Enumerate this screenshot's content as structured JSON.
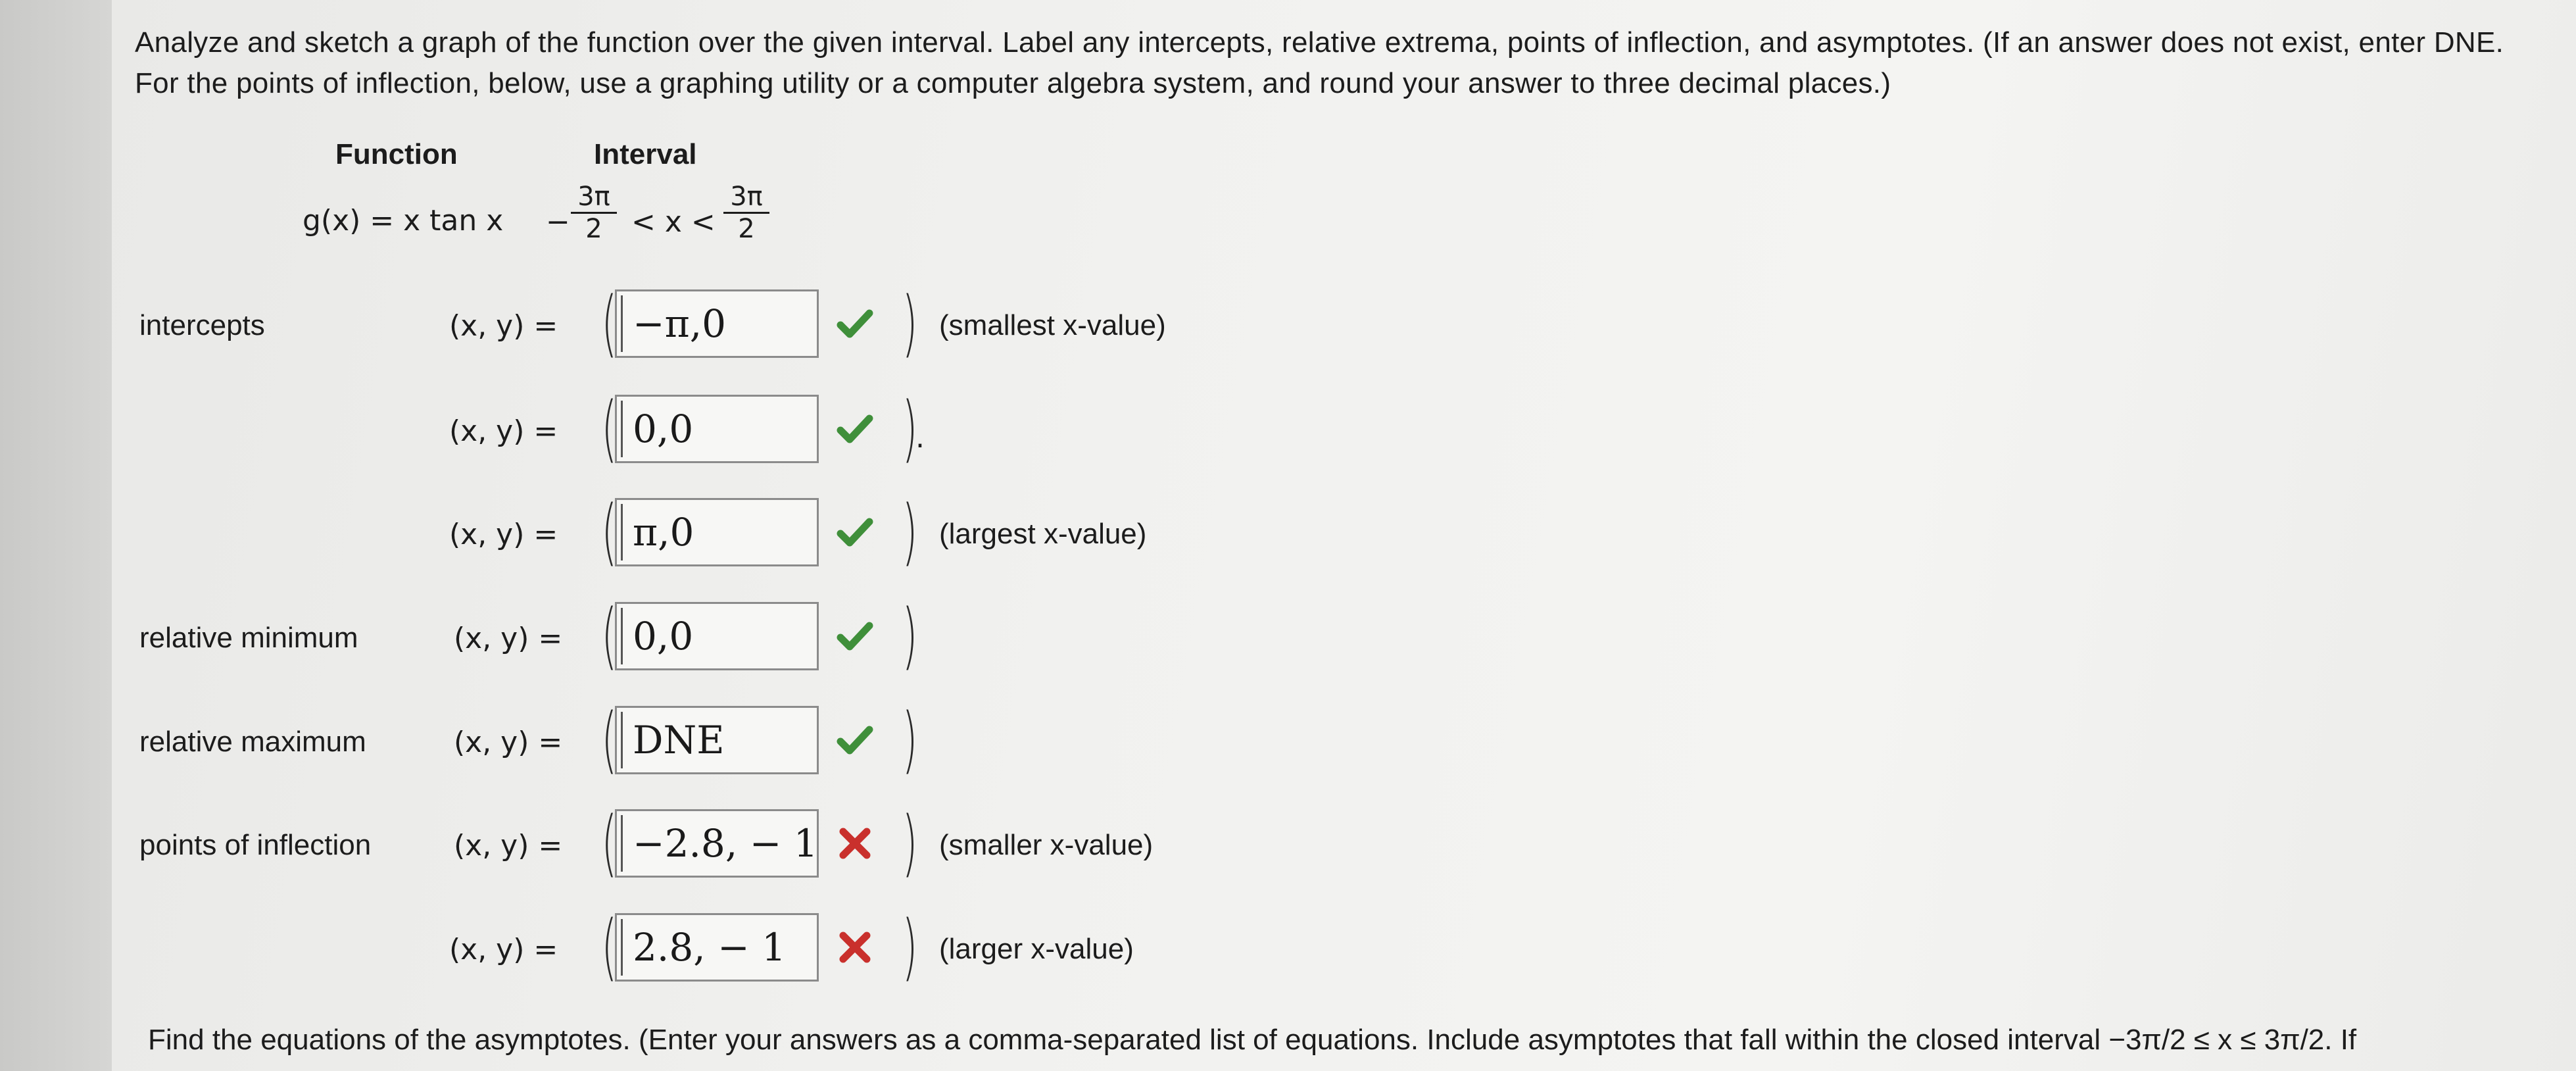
{
  "instructions": "Analyze and sketch a graph of the function over the given interval. Label any intercepts, relative extrema, points of inflection, and asymptotes. (If an answer does not exist, enter DNE. For the points of inflection, below, use a graphing utility or a computer algebra system, and round your answer to three decimal places.)",
  "header": {
    "function": "Function",
    "interval": "Interval"
  },
  "function_expr": "g(x) = x tan x",
  "interval": {
    "minus": "−",
    "num": "3π",
    "den": "2",
    "middle": "< x <"
  },
  "xy_label": "(x, y) =",
  "rows": [
    {
      "label": "intercepts",
      "answer": "−π,0",
      "status": "correct",
      "note": "(smallest x-value)"
    },
    {
      "label": "",
      "answer": "0,0",
      "status": "correct",
      "note": "",
      "trail": "."
    },
    {
      "label": "",
      "answer": "π,0",
      "status": "correct",
      "note": "(largest x-value)"
    },
    {
      "label": "relative minimum",
      "answer": "0,0",
      "status": "correct",
      "note": ""
    },
    {
      "label": "relative maximum",
      "answer": "DNE",
      "status": "correct",
      "note": ""
    },
    {
      "label": "points of inflection",
      "answer": "−2.8, − 1",
      "status": "incorrect",
      "note": "(smaller x-value)"
    },
    {
      "label": "",
      "answer": "2.8, − 1",
      "status": "incorrect",
      "note": "(larger x-value)"
    }
  ],
  "bottom_text": "Find the equations of the asymptotes. (Enter your answers as a comma-separated list of equations. Include asymptotes that fall within the closed interval −3π/2 ≤ x ≤ 3π/2. If",
  "colors": {
    "correct": "#3f8f3a",
    "incorrect": "#c9302c"
  }
}
